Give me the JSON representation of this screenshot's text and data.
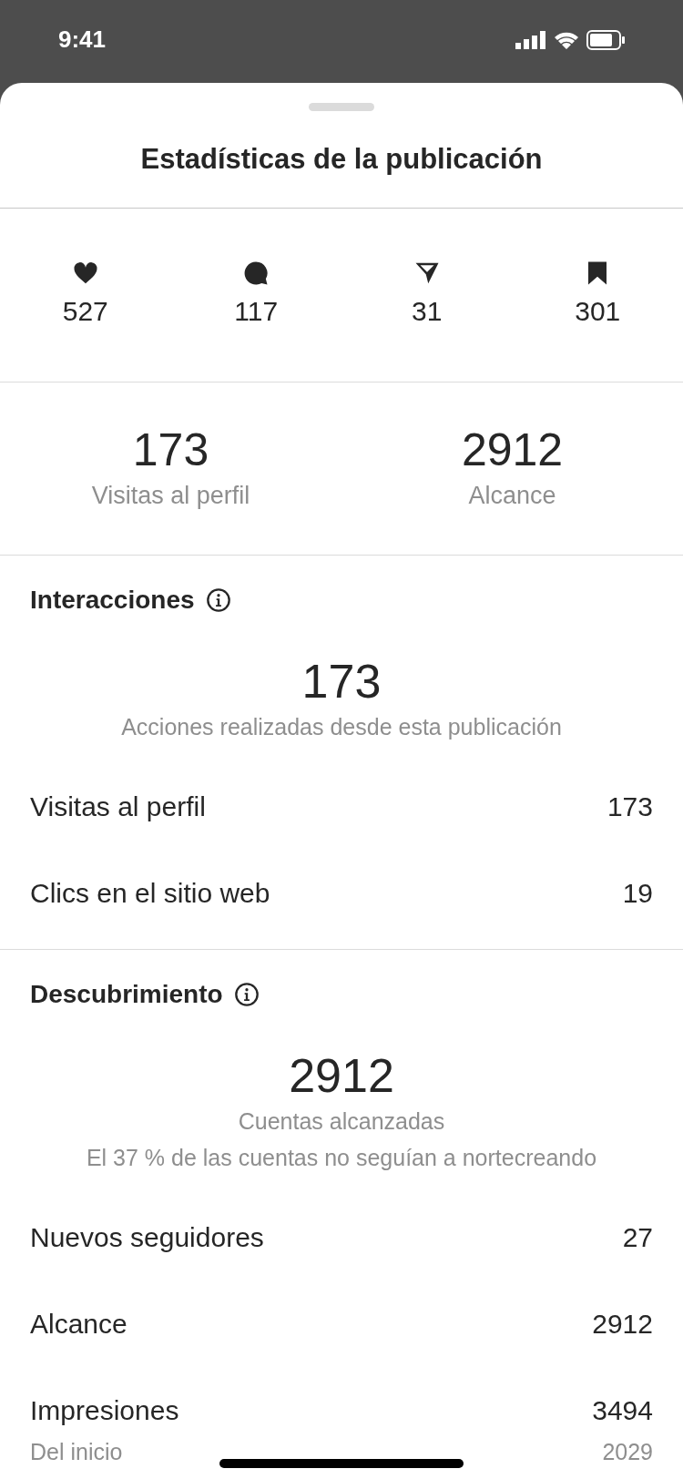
{
  "status_bar": {
    "time": "9:41"
  },
  "title": "Estadísticas de la publicación",
  "counts": [
    {
      "kind": "heart",
      "value": "527"
    },
    {
      "kind": "comment",
      "value": "117"
    },
    {
      "kind": "send",
      "value": "31"
    },
    {
      "kind": "bookmark",
      "value": "301"
    }
  ],
  "summary": [
    {
      "value": "173",
      "label": "Visitas al perfil"
    },
    {
      "value": "2912",
      "label": "Alcance"
    }
  ],
  "sections": [
    {
      "heading": "Interacciones",
      "big_value": "173",
      "captions": [
        "Acciones realizadas desde esta publicación"
      ],
      "rows": [
        {
          "label": "Visitas al perfil",
          "value": "173"
        },
        {
          "label": "Clics en el sitio web",
          "value": "19"
        }
      ]
    },
    {
      "heading": "Descubrimiento",
      "big_value": "2912",
      "captions": [
        "Cuentas alcanzadas",
        "El 37 % de las cuentas no seguían a nortecreando"
      ],
      "rows": [
        {
          "label": "Nuevos seguidores",
          "value": "27"
        },
        {
          "label": "Alcance",
          "value": "2912"
        },
        {
          "label": "Impresiones",
          "value": "3494"
        }
      ]
    }
  ],
  "footer_row": {
    "label": "Del inicio",
    "value": "2029"
  }
}
